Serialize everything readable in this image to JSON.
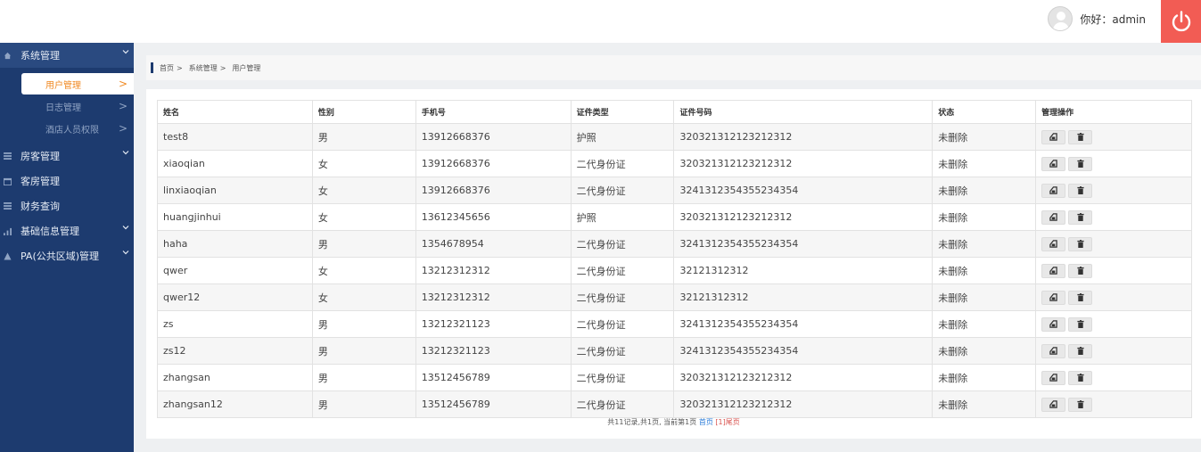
{
  "header": {
    "greeting": "你好：admin"
  },
  "sidebar": {
    "groups": [
      {
        "label": "系统管理",
        "icon": "home-icon"
      },
      {
        "label": "房客管理",
        "icon": "list-icon"
      },
      {
        "label": "客房管理",
        "icon": "calendar-icon"
      },
      {
        "label": "财务查询",
        "icon": "list-icon"
      },
      {
        "label": "基础信息管理",
        "icon": "bar-chart-icon"
      },
      {
        "label": "PA(公共区域)管理",
        "icon": "warning-icon"
      }
    ],
    "sub_items": [
      {
        "label": "用户管理",
        "arrow": ">"
      },
      {
        "label": "日志管理",
        "arrow": ">"
      },
      {
        "label": "酒店人员权限",
        "arrow": ">"
      }
    ]
  },
  "breadcrumb": {
    "items": [
      "首页",
      "系统管理",
      "用户管理"
    ],
    "sep": ">"
  },
  "table": {
    "headers": [
      "姓名",
      "性别",
      "手机号",
      "证件类型",
      "证件号码",
      "状态",
      "管理操作"
    ],
    "rows": [
      [
        "test8",
        "男",
        "13912668376",
        "护照",
        "320321312123212312",
        "未删除"
      ],
      [
        "xiaoqian",
        "女",
        "13912668376",
        "二代身份证",
        "320321312123212312",
        "未删除"
      ],
      [
        "linxiaoqian",
        "女",
        "13912668376",
        "二代身份证",
        "3241312354355234354",
        "未删除"
      ],
      [
        "huangjinhui",
        "女",
        "13612345656",
        "护照",
        "320321312123212312",
        "未删除"
      ],
      [
        "haha",
        "男",
        "1354678954",
        "二代身份证",
        "3241312354355234354",
        "未删除"
      ],
      [
        "qwer",
        "女",
        "13212312312",
        "二代身份证",
        "32121312312",
        "未删除"
      ],
      [
        "qwer12",
        "女",
        "13212312312",
        "二代身份证",
        "32121312312",
        "未删除"
      ],
      [
        "zs",
        "男",
        "13212321123",
        "二代身份证",
        "3241312354355234354",
        "未删除"
      ],
      [
        "zs12",
        "男",
        "13212321123",
        "二代身份证",
        "3241312354355234354",
        "未删除"
      ],
      [
        "zhangsan",
        "男",
        "13512456789",
        "二代身份证",
        "320321312123212312",
        "未删除"
      ],
      [
        "zhangsan12",
        "男",
        "13512456789",
        "二代身份证",
        "320321312123212312",
        "未删除"
      ]
    ]
  },
  "pager": {
    "summary": "共11记录,共1页, 当前第1页",
    "first": "首页",
    "current": "[1]",
    "last": "尾页"
  },
  "colors": {
    "sidebar_bg": "#1d3b6f",
    "power_btn": "#f25c54",
    "active_text": "#f08a24"
  }
}
